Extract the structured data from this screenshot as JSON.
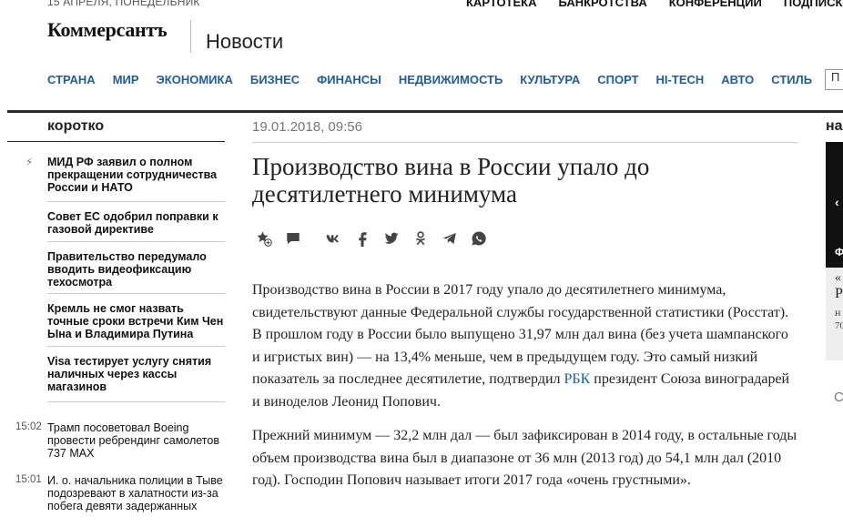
{
  "header": {
    "date": "15 АПРЕЛЯ, ПОНЕДЕЛЬНИК",
    "top_links": [
      "КАРТОТЕКА",
      "БАНКРОТСТВА",
      "КОНФЕРЕНЦИИ",
      "ПОДПИСКА"
    ],
    "logo": "Коммерсантъ",
    "section": "Новости",
    "nav": [
      "СТРАНА",
      "МИР",
      "ЭКОНОМИКА",
      "БИЗНЕС",
      "ФИНАНСЫ",
      "НЕДВИЖИМОСТЬ",
      "КУЛЬТУРА",
      "СПОРТ",
      "HI-TECH",
      "АВТО",
      "СТИЛЬ"
    ],
    "search_label": "П"
  },
  "sidebar": {
    "title": "коротко",
    "briefs": [
      "МИД РФ заявил о полном прекращении сотрудничества России и НАТО",
      "Совет ЕС одобрил поправки к газовой директиве",
      "Правительство передумало вводить видеофиксацию техосмотра",
      "Кремль не смог назвать точные сроки встречи Ким Чен Ына и Владимира Путина",
      "Visa тестирует услугу снятия наличных через кассы магазинов"
    ],
    "news": [
      {
        "time": "15:02",
        "text": "Трамп посоветовал Boeing провести ребрендинг самолетов 737 MAX"
      },
      {
        "time": "15:01",
        "text": "И. о. начальника полиции в Тыве подозревают в халатности из-за побега девяти задержанных"
      }
    ]
  },
  "article": {
    "date": "19.01.2018, 09:56",
    "title": "Производство вина в России упало до десятилетнего минимума",
    "p1": "Производство вина в России в 2017 году упало до десятилетнего минимума, свидетельствуют данные Федеральной службы государственной статистики (Росстат). В прошлом году в России было выпущено 31,97 млн дал вина (без учета шампанского и игристых вин) — на 13,4% меньше, чем в предыдущем году. Это самый низкий показатель за последнее десятилетие, подтвердил",
    "p1_link": "РБК",
    "p1_end": "президент Союза виноградарей и виноделов Леонид Попович.",
    "p2": "Прежний минимум — 32,2 млн дал — был зафиксирован в 2014 году, в остальные годы объем производства вина был в диапазоне от 36 млн (2013 год) до 54,1 млн дал (2010 год). Господин Попович называет итоги 2017 года «очень грустными»."
  },
  "right": {
    "title": "на",
    "arrow": "‹",
    "label": "Ф",
    "card_quote": "«",
    "card_letter": "Р",
    "card_num1": "н",
    "card_num2": "70",
    "c_letter": "С"
  },
  "colors": {
    "link": "#1a5fa6",
    "rule": "#2a2a2a"
  }
}
